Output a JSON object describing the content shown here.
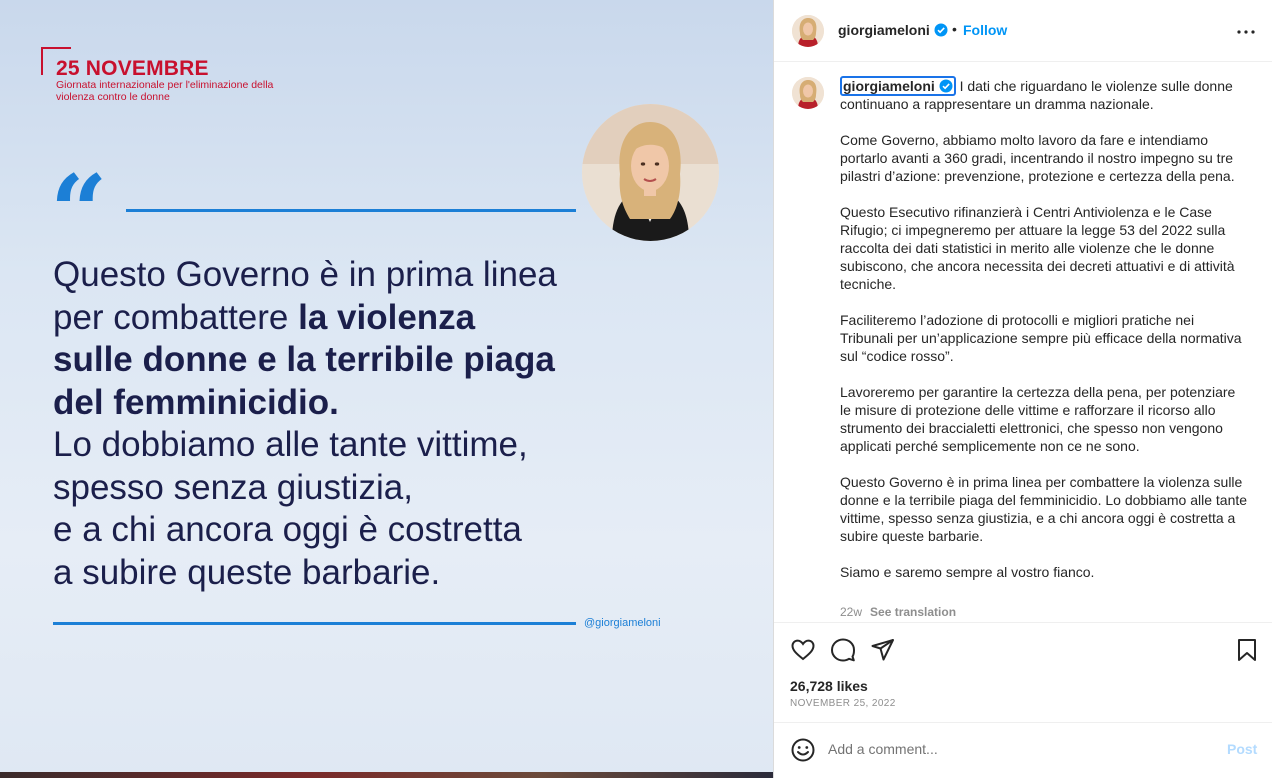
{
  "image": {
    "event_title": "25 NOVEMBRE",
    "event_subtitle": "Giornata internazionale per l'eliminazione della violenza contro le donne",
    "quote_mark": "“",
    "quote": {
      "line1": "Questo Governo è in prima linea",
      "line2_normal": "per combattere ",
      "line2_bold": "la violenza",
      "line3_bold": "sulle donne e la terribile piaga",
      "line4_bold": "del femminicidio.",
      "line5": "Lo dobbiamo alle tante vittime,",
      "line6": "spesso senza giustizia,",
      "line7": "e a chi ancora oggi è costretta",
      "line8": "a subire queste barbarie."
    },
    "handle": "@giorgiameloni",
    "colors": {
      "accent_red": "#c8102e",
      "accent_blue": "#1c7fd6",
      "text_navy": "#1b1f4b"
    }
  },
  "header": {
    "username": "giorgiameloni",
    "dot": "•",
    "follow_label": "Follow"
  },
  "caption": {
    "username": "giorgiameloni",
    "first_text": "I dati che riguardano le violenze sulle donne continuano a rappresentare un dramma nazionale.",
    "paragraphs": [
      "Come Governo, abbiamo molto lavoro da fare e intendiamo portarlo avanti a 360 gradi, incentrando il nostro impegno su tre pilastri d’azione: prevenzione, protezione e certezza della pena.",
      "Questo Esecutivo rifinanzierà i Centri Antiviolenza e le Case Rifugio; ci impegneremo per attuare la legge 53 del 2022 sulla raccolta dei dati statistici in merito alle violenze che le donne subiscono, che ancora necessita dei decreti attuativi e di attività tecniche.",
      "Faciliteremo l’adozione di protocolli e migliori pratiche nei Tribunali per un’applicazione sempre più efficace della normativa sul “codice rosso”.",
      "Lavoreremo per garantire la certezza della pena, per potenziare le misure di protezione delle vittime e rafforzare il ricorso allo strumento dei braccialetti elettronici, che spesso non vengono applicati perché semplicemente non ce ne sono.",
      "Questo Governo è in prima linea per combattere la violenza sulle donne e la terribile piaga del femminicidio. Lo dobbiamo alle tante vittime, spesso senza giustizia, e a chi ancora oggi è costretta a subire queste barbarie.",
      "Siamo e saremo sempre al vostro fianco."
    ],
    "age": "22w",
    "see_translation": "See translation"
  },
  "actions": {
    "likes": "26,728 likes",
    "date": "NOVEMBER 25, 2022",
    "icons": [
      "heart-icon",
      "comment-icon",
      "share-icon",
      "bookmark-icon"
    ]
  },
  "comment": {
    "placeholder": "Add a comment...",
    "post_label": "Post"
  }
}
